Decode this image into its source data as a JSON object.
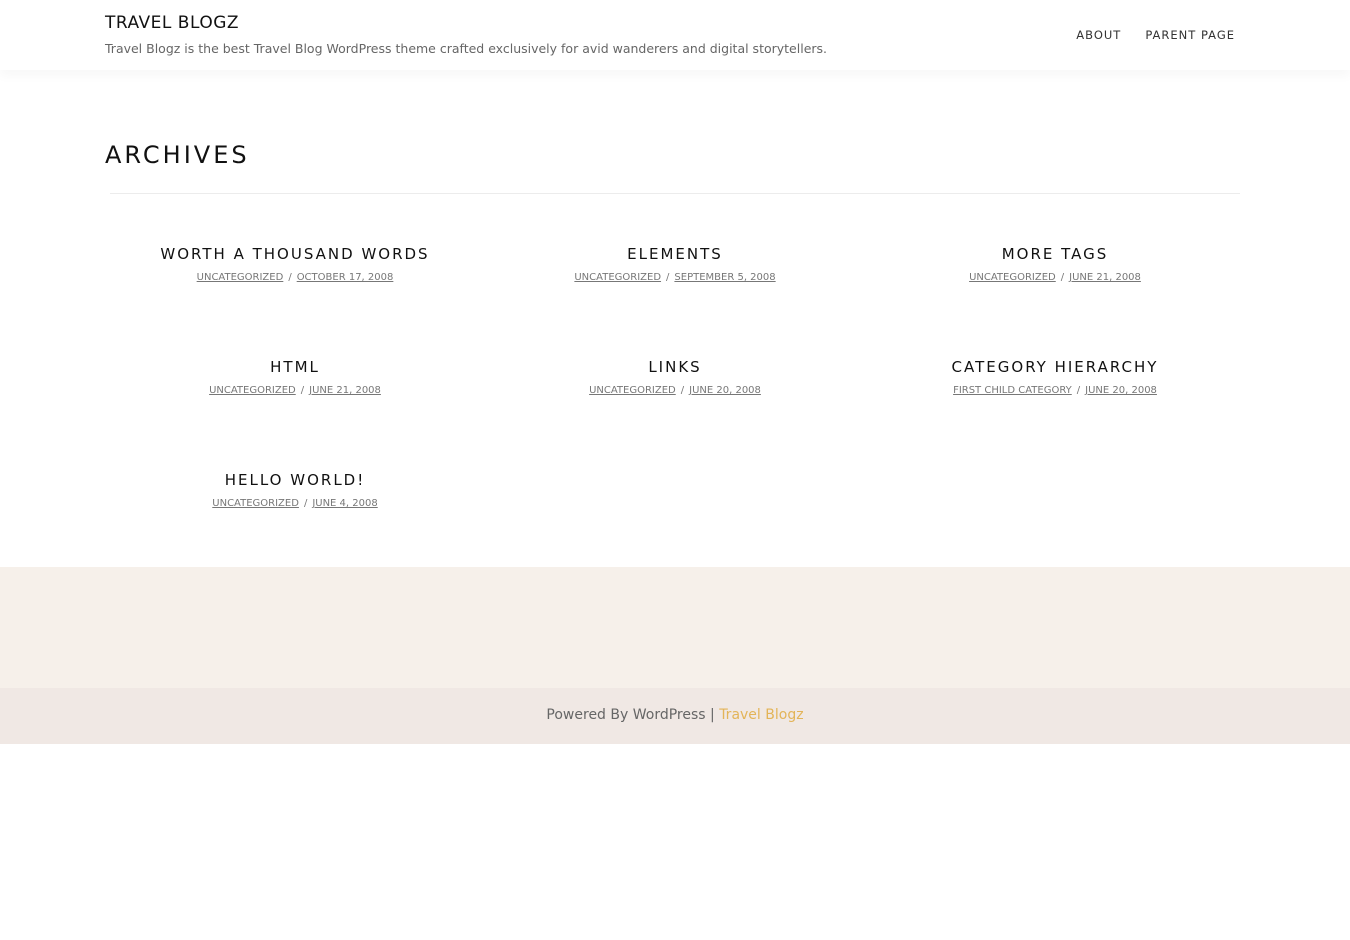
{
  "header": {
    "site_title": "TRAVEL BLOGZ",
    "site_description": "Travel Blogz is the best Travel Blog WordPress theme crafted exclusively for avid wanderers and digital storytellers.",
    "nav": [
      {
        "label": "ABOUT"
      },
      {
        "label": "PARENT PAGE"
      }
    ]
  },
  "main": {
    "page_title": "ARCHIVES",
    "meta_separator": "/",
    "posts": [
      {
        "title": "WORTH A THOUSAND WORDS",
        "category": "UNCATEGORIZED",
        "date": "OCTOBER 17, 2008"
      },
      {
        "title": "ELEMENTS",
        "category": "UNCATEGORIZED",
        "date": "SEPTEMBER 5, 2008"
      },
      {
        "title": "MORE TAGS",
        "category": "UNCATEGORIZED",
        "date": "JUNE 21, 2008"
      },
      {
        "title": "HTML",
        "category": "UNCATEGORIZED",
        "date": "JUNE 21, 2008"
      },
      {
        "title": "LINKS",
        "category": "UNCATEGORIZED",
        "date": "JUNE 20, 2008"
      },
      {
        "title": "CATEGORY HIERARCHY",
        "category": "FIRST CHILD CATEGORY",
        "date": "JUNE 20, 2008"
      },
      {
        "title": "HELLO WORLD!",
        "category": "UNCATEGORIZED",
        "date": "JUNE 4, 2008"
      }
    ]
  },
  "footer": {
    "powered_text": "Powered By WordPress |",
    "theme_link": "Travel Blogz"
  },
  "colors": {
    "accent": "#e3b458",
    "footer_widgets_bg": "#f6f0ea",
    "footer_bottom_bg": "#f0e8e4"
  }
}
